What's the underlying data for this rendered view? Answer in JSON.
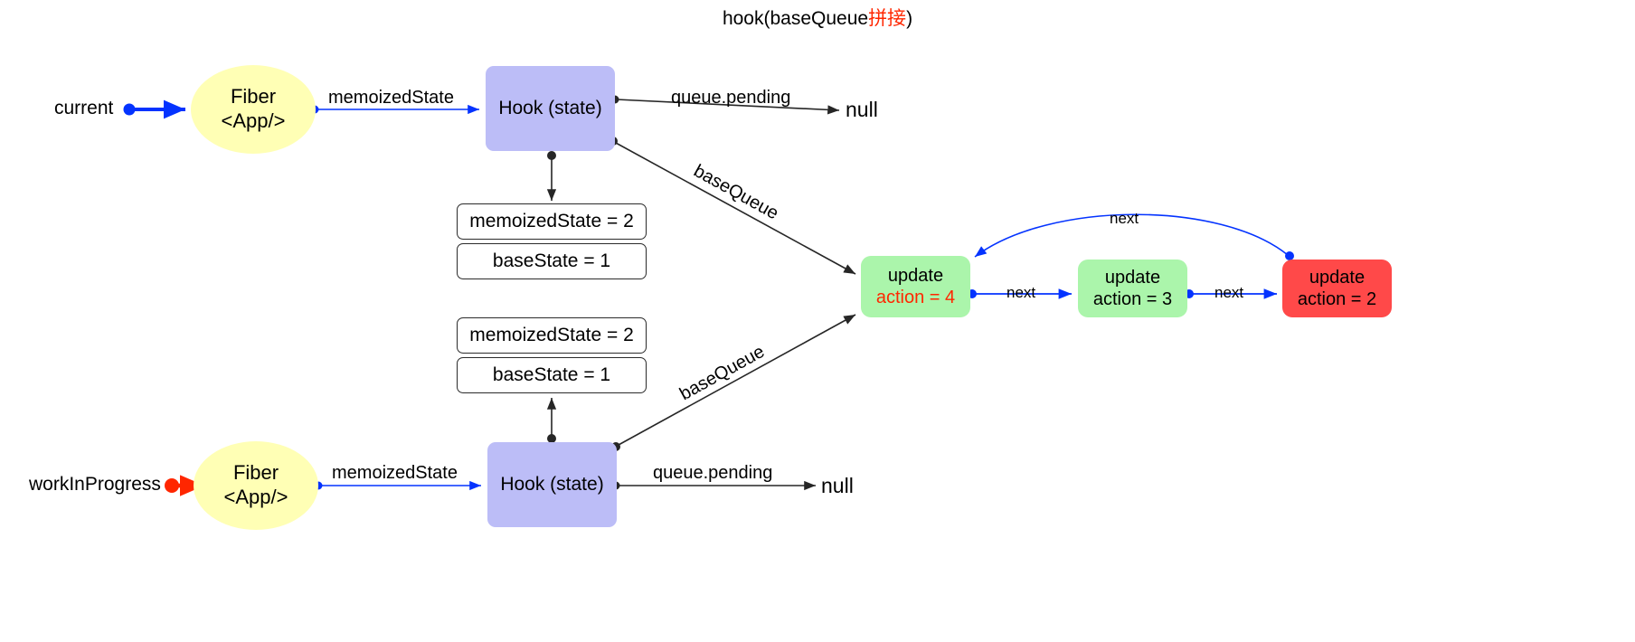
{
  "title": {
    "prefix": "hook(baseQueue",
    "cn": "拼接",
    "suffix": ")"
  },
  "colors": {
    "fiber_fill": "#ffffb5",
    "hook_fill": "#bcbdf7",
    "update_green": "#abf5ab",
    "update_red": "#ff4949",
    "accent_blue": "#0433ff",
    "accent_red": "#ff2600",
    "edge_black": "#262626"
  },
  "roots": {
    "current": {
      "label": "current",
      "marker_color": "#0433ff"
    },
    "workInProgress": {
      "label": "workInProgress",
      "marker_color": "#ff2600"
    }
  },
  "fibers": {
    "current": {
      "line1": "Fiber",
      "line2": "<App/>"
    },
    "wip": {
      "line1": "Fiber",
      "line2": "<App/>"
    }
  },
  "hooks": {
    "current": {
      "label": "Hook (state)"
    },
    "wip": {
      "label": "Hook (state)"
    }
  },
  "edges": {
    "memoizedState_top": "memoizedState",
    "memoizedState_bottom": "memoizedState",
    "queue_pending_top": "queue.pending",
    "queue_pending_bottom": "queue.pending",
    "baseQueue_top": "baseQueue",
    "baseQueue_bottom": "baseQueue",
    "next_1": "next",
    "next_2": "next",
    "next_loop": "next"
  },
  "nulls": {
    "top": "null",
    "bottom": "null"
  },
  "state_tables": {
    "top": [
      {
        "label": "memoizedState = 2"
      },
      {
        "label": "baseState = 1"
      }
    ],
    "bottom": [
      {
        "label": "memoizedState = 2"
      },
      {
        "label": "baseState = 1"
      }
    ]
  },
  "updates": [
    {
      "id": "update-4",
      "title": "update",
      "action": "action = 4",
      "variant": "green",
      "action_red": true
    },
    {
      "id": "update-3",
      "title": "update",
      "action": "action = 3",
      "variant": "green",
      "action_red": false
    },
    {
      "id": "update-2",
      "title": "update",
      "action": "action = 2",
      "variant": "red",
      "action_red": false
    }
  ]
}
